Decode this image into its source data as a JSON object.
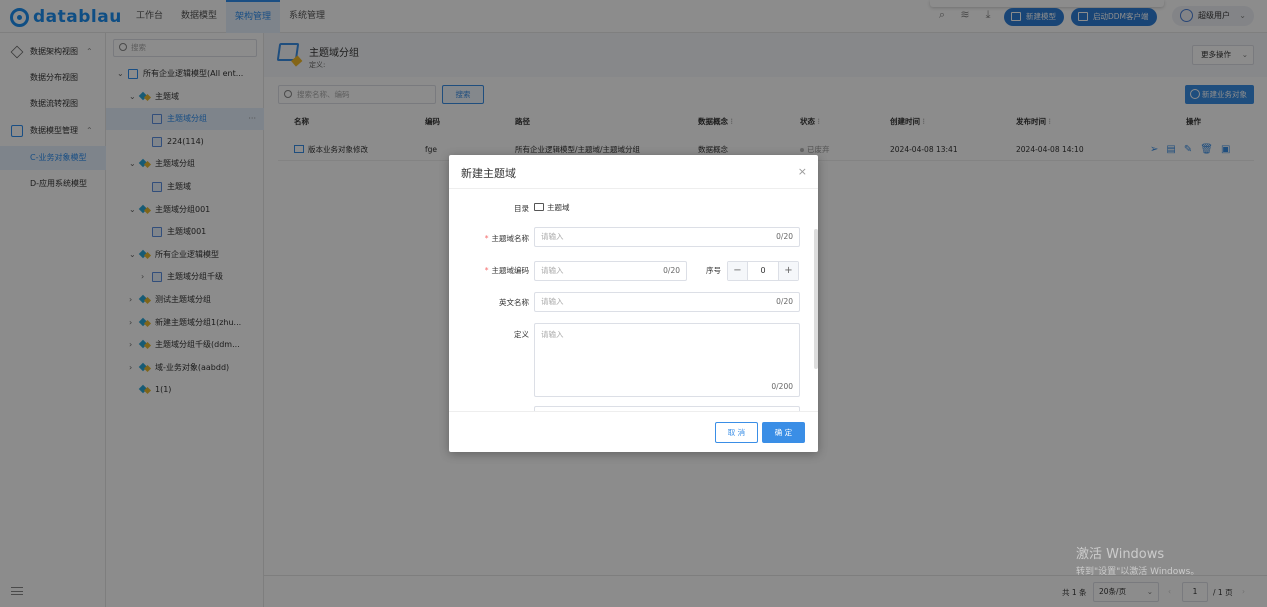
{
  "app": {
    "logo_text": "datablau"
  },
  "topnav": {
    "menu": [
      {
        "label": "工作台",
        "active": false
      },
      {
        "label": "数据模型",
        "active": false
      },
      {
        "label": "架构管理",
        "active": true
      },
      {
        "label": "系统管理",
        "active": false
      }
    ],
    "new_model_label": "新建模型",
    "start_ddm_label": "启动DDM客户端",
    "user_label": "超级用户"
  },
  "leftnav": {
    "groups": [
      {
        "label": "数据架构视图",
        "icon": "cube-icon",
        "items": [
          "数据分布视图",
          "数据流转视图"
        ]
      },
      {
        "label": "数据模型管理",
        "icon": "model-icon",
        "items": [
          "C-业务对象模型",
          "D-应用系统模型"
        ]
      }
    ],
    "active_item": "C-业务对象模型"
  },
  "tree": {
    "search_placeholder": "搜索",
    "nodes": [
      {
        "label": "所有企业逻辑模型(All ent...",
        "indent": 0,
        "arrow": "v",
        "icon": "folder"
      },
      {
        "label": "主题域",
        "indent": 1,
        "arrow": "v",
        "icon": "domain"
      },
      {
        "label": "主题域分组",
        "indent": 2,
        "arrow": "",
        "icon": "object",
        "active": true,
        "more": "···"
      },
      {
        "label": "224(114)",
        "indent": 2,
        "arrow": "",
        "icon": "object"
      },
      {
        "label": "主题域分组",
        "indent": 1,
        "arrow": "v",
        "icon": "domain"
      },
      {
        "label": "主题域",
        "indent": 2,
        "arrow": "",
        "icon": "object"
      },
      {
        "label": "主题域分组001",
        "indent": 1,
        "arrow": "v",
        "icon": "domain"
      },
      {
        "label": "主题域001",
        "indent": 2,
        "arrow": "",
        "icon": "object"
      },
      {
        "label": "所有企业逻辑模型",
        "indent": 1,
        "arrow": "v",
        "icon": "domain"
      },
      {
        "label": "主题域分组千级",
        "indent": 2,
        "arrow": ">",
        "icon": "object"
      },
      {
        "label": "测试主题域分组",
        "indent": 1,
        "arrow": ">",
        "icon": "domain"
      },
      {
        "label": "新建主题域分组1(zhu...",
        "indent": 1,
        "arrow": ">",
        "icon": "domain"
      },
      {
        "label": "主题域分组千级(ddm...",
        "indent": 1,
        "arrow": ">",
        "icon": "domain"
      },
      {
        "label": "域-业务对象(aabdd)",
        "indent": 1,
        "arrow": ">",
        "icon": "domain"
      },
      {
        "label": "1(1)",
        "indent": 1,
        "arrow": "",
        "icon": "domain"
      }
    ]
  },
  "main": {
    "title": "主题域分组",
    "definition": "定义:",
    "more_actions": "更多操作",
    "search_placeholder": "搜索名称、编码",
    "search_button": "搜索",
    "new_object_button": "新建业务对象",
    "columns": [
      "名称",
      "编码",
      "路径",
      "数据概念",
      "状态",
      "创建时间",
      "发布时间",
      "操作"
    ],
    "rows": [
      {
        "name": "版本业务对象修改",
        "code": "fge",
        "path": "所有企业逻辑模型/主题域/主题域分组",
        "concept": "数据概念",
        "status": "已废弃",
        "created": "2024-04-08 13:41",
        "published": "2024-04-08 14:10"
      }
    ],
    "pagination": {
      "total": "共 1 条",
      "page_size": "20条/页",
      "page": "1",
      "pages": "/ 1 页"
    }
  },
  "modal": {
    "title": "新建主题域",
    "close": "×",
    "dir_label": "目录",
    "dir_value": "主题域",
    "name_label": "主题域名称",
    "name_placeholder": "请输入",
    "name_count": "0/20",
    "code_label": "主题域编码",
    "code_placeholder": "请输入",
    "code_count": "0/20",
    "seq_label": "序号",
    "seq_value": "0",
    "seq_minus": "−",
    "seq_plus": "+",
    "en_label": "英文名称",
    "en_placeholder": "请输入",
    "en_count": "0/20",
    "def_label": "定义",
    "def_placeholder": "请输入",
    "def_count": "0/200",
    "cancel": "取 消",
    "ok": "确 定"
  },
  "watermark": {
    "line1": "激活 Windows",
    "line2": "转到\"设置\"以激活 Windows。"
  }
}
